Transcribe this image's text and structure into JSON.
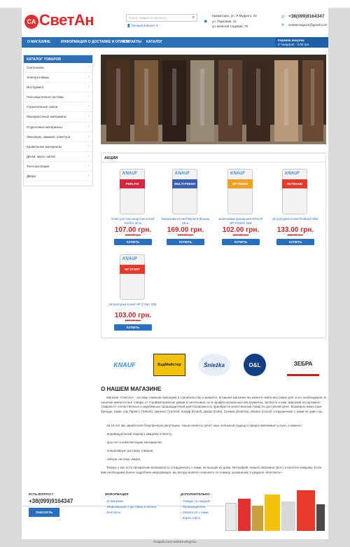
{
  "topbar": {
    "wishlist": "Мои закладки (0)",
    "cart": "Корзина покупок",
    "checkout": "Оформление заказа"
  },
  "header": {
    "logo_letters": "СА",
    "logo_text": "СветАн",
    "search_placeholder": "Поиск товара по каталогу",
    "account": "Личный кабинет",
    "address_1": "Краматорск, ул. Я.Мудрого, 22",
    "address_2": "ул. Парковая, 41",
    "address_3": "ул. Бельгия Садовая, 75",
    "phone": "+38(099)9164347",
    "email": "svetanmagazin@gmail.com"
  },
  "nav": {
    "items": [
      "О МАГАЗИНЕ",
      "ИНФОРМАЦИЯ О ДОСТАВКЕ И ОПЛАТЕ",
      "КОНТАКТЫ",
      "КАТАЛОГ"
    ],
    "cart_title": "Корзина покупок",
    "cart_info": "0 товар(ов) - 0.00 грн."
  },
  "sidebar": {
    "title": "КАТАЛОГ ТОВАРОВ",
    "items": [
      "Сантехника",
      "Электротовары",
      "Инструмент",
      "Гипсокартонные системы",
      "Строительные смеси",
      "Лакокрасочные материалы",
      "Отделочные материалы",
      "Линолеум, ламинат, плинтуса",
      "Кровельные материалы",
      "Диски, круги, щётки",
      "Теплоизоляция",
      "Двери"
    ]
  },
  "sale": {
    "title": "АКЦИИ",
    "buy": "КУПИТЬ",
    "products": [
      {
        "name": "Клей для гипсокартона Knauf PerlFix 30 кг",
        "price": "107.00 грн.",
        "old": "112.00 грн.",
        "band": "PERLFIX",
        "band_color": "#d7263d"
      },
      {
        "name": "Шпаклевка Knauf Мульти-Финиш 25 кг",
        "price": "169.00 грн.",
        "old": "172.00 грн.",
        "band": "MULTI-FINISH",
        "band_color": "#3a5fb0"
      },
      {
        "name": "Шпатлевка финишная KNAUF HP-FINISH 25кг",
        "price": "102.00 грн.",
        "old": "105.00 грн.",
        "band": "HP FINISH",
        "band_color": "#f0a020"
      },
      {
        "name": "Штукатурка Knauf Rotband 30кг",
        "price": "133.00 грн.",
        "old": "135.00 грн.",
        "band": "ROTBAND",
        "band_color": "#e8392b"
      },
      {
        "name": "Штукатурка Knauf HP Старт 30кг",
        "price": "103.00 грн.",
        "old": "120.00 грн.",
        "band": "HP START",
        "band_color": "#e8392b"
      }
    ]
  },
  "brands": [
    "KNAUF",
    "БудМайстер",
    "Śnieżka",
    "O&L",
    "ЗЕБРА"
  ],
  "about": {
    "title": "О НАШЕМ МАГАЗИНЕ",
    "p1": "Магазин «СветАн» - это ваш главный помощник в строительстве и ремонте. В нашем магазине вы можете найти все ровно для этого необходимое. В наличии имеются все товары от стройматериалов, двери и сантехника, но и профессиональные инструменты, запчасти к ним. Широкий ассортимент товаров от отечественных и зарубежных производителей дает возможность приобрести качественный товар по доступной цене. Всемирно известные бренды, такие, как Таркетт (Tarkett), Церезит (Ceresit), Кнауф (Knauf), Дюфа (Dufa), Снежка (Sniezka), Ивзинг (Izovol) сотрудничают с нами не один год.",
    "p2": "За 19 лет мы заработали безупречную репутацию. Наши клиенты ценят наш лояльный подход и предоставляемые услуги, а именно:",
    "list": [
      "- индивидуальный подход к каждому клиенту;",
      "- просчет и комплектацию материалов;",
      "- оперативную доставку  товаров;",
      "- гибкую систему  скидок."
    ],
    "p3": "Теперь у вас есть прекрасная возможность сотрудничать с нами, не выходя из дома. Интерфейс нашего магазина прост и понятен каждому. Если вам необходима более подробная информация, вы всегда можете позвонить по номеру, указанному в разделе «Контакты»."
  },
  "footer": {
    "question": "ЕСТЬ ВОПРОС?",
    "phone": "+38(099)9164347",
    "call": "ЗАКАЗАТЬ ЗВОНОК",
    "info_title": "ИНФОРМАЦИЯ",
    "info": [
      "О магазине",
      "Информация о доставке и оплате",
      "Контакты"
    ],
    "extra_title": "ДОПОЛНИТЕЛЬНО",
    "extra": [
      "Товары со скидкой",
      "Производители",
      "Связаться с нами",
      "Карта сайта"
    ],
    "copyright": "Разработано WebDevelopYou"
  }
}
